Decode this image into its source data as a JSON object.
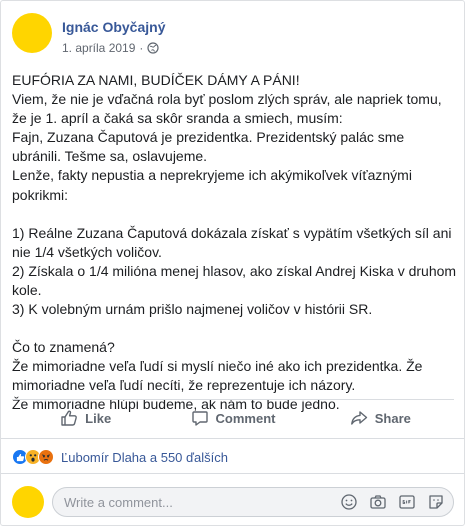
{
  "post": {
    "author": "Ignác Obyčajný",
    "date": "1. apríla 2019",
    "date_separator": "·",
    "privacy_icon": "globe-icon",
    "paragraphs": [
      "EUFÓRIA ZA NAMI, BUDÍČEK DÁMY A PÁNI!",
      "Viem, že nie je vďačná rola byť poslom zlých správ, ale napriek tomu, že je 1. apríl a čaká sa skôr sranda a smiech, musím:",
      "Fajn, Zuzana Čaputová je prezidentka. Prezidentský palác sme ubránili. Tešme sa, oslavujeme.",
      "Lenže, fakty nepustia a neprekryjeme ich akýmikoľvek víťaznými pokrikmi:",
      "",
      "1) Reálne Zuzana Čaputová dokázala získať s vypätím všetkých síl ani nie 1/4 všetkých voličov.",
      "2) Získala o 1/4 milióna menej hlasov, ako získal Andrej Kiska v druhom kole.",
      "3) K volebným urnám prišlo najmenej voličov v histórii SR.",
      "",
      "Čo to znamená?",
      "Že mimoriadne veľa ľudí si myslí niečo iné ako ich prezidentka. Že mimoriadne veľa ľudí necíti, že reprezentuje ich názory.",
      "Že mimoriadne hlúpi budeme, ak nám to bude jedno."
    ]
  },
  "actions": {
    "like_label": "Like",
    "comment_label": "Comment",
    "share_label": "Share"
  },
  "reactions": {
    "types": [
      "like",
      "wow",
      "angry"
    ],
    "summary": "Ľubomír Dlaha a 550 ďalších"
  },
  "comment": {
    "placeholder": "Write a comment...",
    "tools": [
      "emoji-icon",
      "camera-icon",
      "gif-icon",
      "sticker-icon"
    ]
  },
  "colors": {
    "accent": "#385898",
    "avatar": "#ffd500",
    "muted": "#606770"
  }
}
